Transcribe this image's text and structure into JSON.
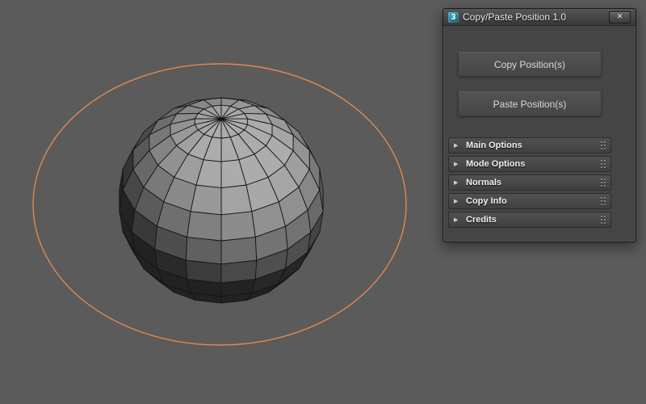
{
  "window": {
    "title": "Copy/Paste Position 1.0",
    "app_icon_text": "3",
    "close_label": "✕"
  },
  "actions": {
    "copy_button": "Copy Position(s)",
    "paste_button": "Paste Position(s)"
  },
  "rollout_arrow": "▶",
  "rollouts": [
    {
      "label": "Main Options",
      "expanded": false
    },
    {
      "label": "Mode Options",
      "expanded": false
    },
    {
      "label": "Normals",
      "expanded": false
    },
    {
      "label": "Copy Info",
      "expanded": false
    },
    {
      "label": "Credits",
      "expanded": false
    }
  ],
  "scene": {
    "objects": [
      "wireframe-sphere",
      "circle-spline"
    ]
  },
  "colors": {
    "viewport_bg": "#5b5b5b",
    "ring_stroke": "#dd8a52",
    "wireframe": "#151515",
    "app_icon_teal": "#2e8ba0"
  }
}
